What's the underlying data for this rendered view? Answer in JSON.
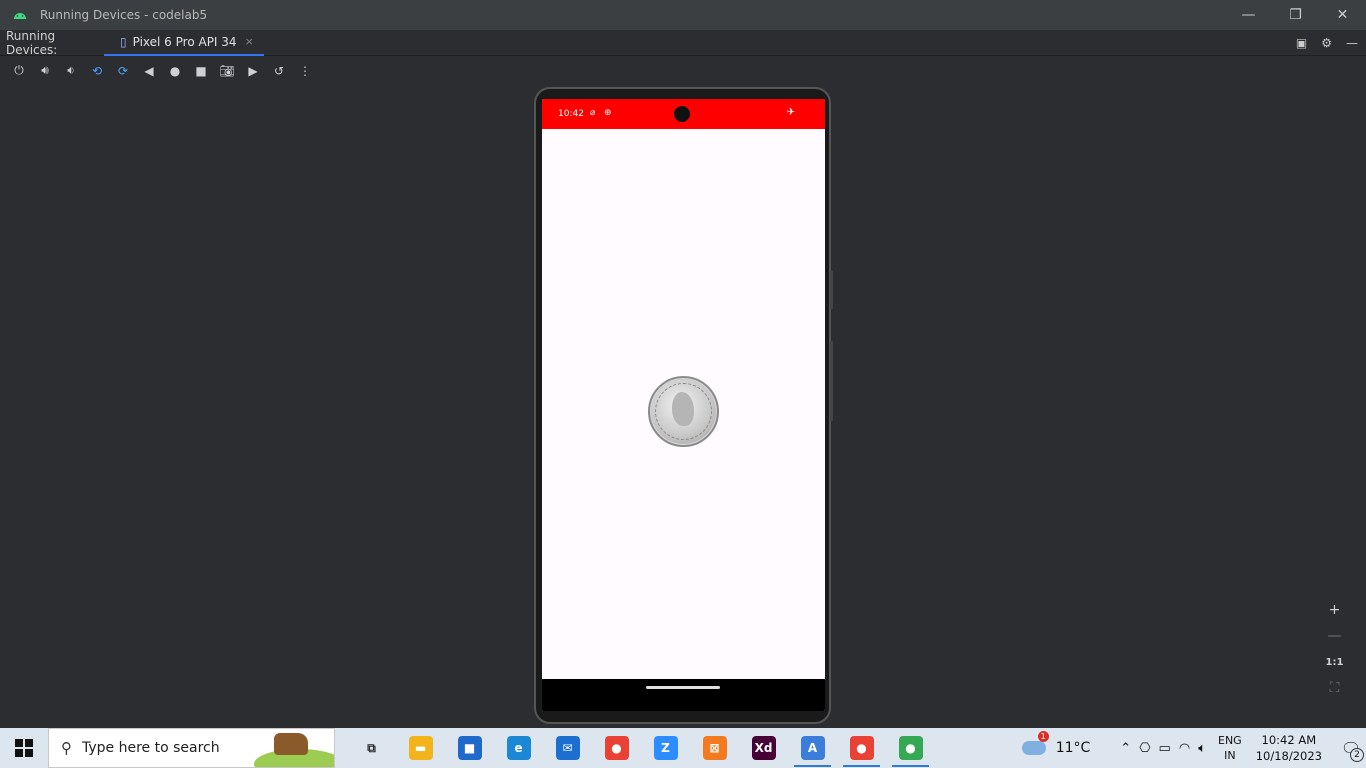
{
  "window": {
    "title": "Running Devices - codelab5",
    "minimize": "—",
    "restore": "❐",
    "close": "✕"
  },
  "tabbar": {
    "label": "Running Devices:",
    "tab": {
      "label": "Pixel 6 Pro API 34",
      "close": "×"
    }
  },
  "toolbar": {
    "items": [
      "power-icon",
      "volume-up-icon",
      "volume-down-icon",
      "rotate-left-icon",
      "rotate-right-icon",
      "back-icon",
      "home-icon",
      "overview-icon",
      "screenshot-icon",
      "screen-record-icon",
      "reset-icon",
      "more-icon"
    ]
  },
  "device": {
    "status_time": "10:42",
    "status_icon_1": "⌀",
    "status_icon_2": "⊕",
    "status_icon_right": "✈"
  },
  "zoom": {
    "plus": "+",
    "minus": "—",
    "one_to_one": "1:1",
    "fit": "⛶"
  },
  "taskbar": {
    "search_placeholder": "Type here to search",
    "apps": [
      {
        "name": "task-view",
        "glyph": "⧉",
        "color": "#2a2a2a"
      },
      {
        "name": "file-explorer",
        "glyph": "▬",
        "color": "#f2b31b"
      },
      {
        "name": "microsoft-store",
        "glyph": "■",
        "color": "#1e69c9"
      },
      {
        "name": "edge",
        "glyph": "e",
        "color": "#1b87d5"
      },
      {
        "name": "mail",
        "glyph": "✉",
        "color": "#1c6fd1"
      },
      {
        "name": "chrome",
        "glyph": "●",
        "color": "#e94235"
      },
      {
        "name": "zoom",
        "glyph": "Z",
        "color": "#2d8cff"
      },
      {
        "name": "xampp",
        "glyph": "⊠",
        "color": "#f47a20"
      },
      {
        "name": "adobe-xd",
        "glyph": "Xd",
        "color": "#470137"
      },
      {
        "name": "android-studio",
        "glyph": "A",
        "color": "#3b7dd8"
      },
      {
        "name": "chrome-profile-s",
        "glyph": "●",
        "color": "#e94235"
      },
      {
        "name": "chrome-profile-2",
        "glyph": "●",
        "color": "#34a853"
      }
    ],
    "weather_badge": "1",
    "temperature": "11°C",
    "lang_top": "ENG",
    "lang_bottom": "IN",
    "time": "10:42 AM",
    "date": "10/18/2023",
    "notifications_count": "2"
  }
}
